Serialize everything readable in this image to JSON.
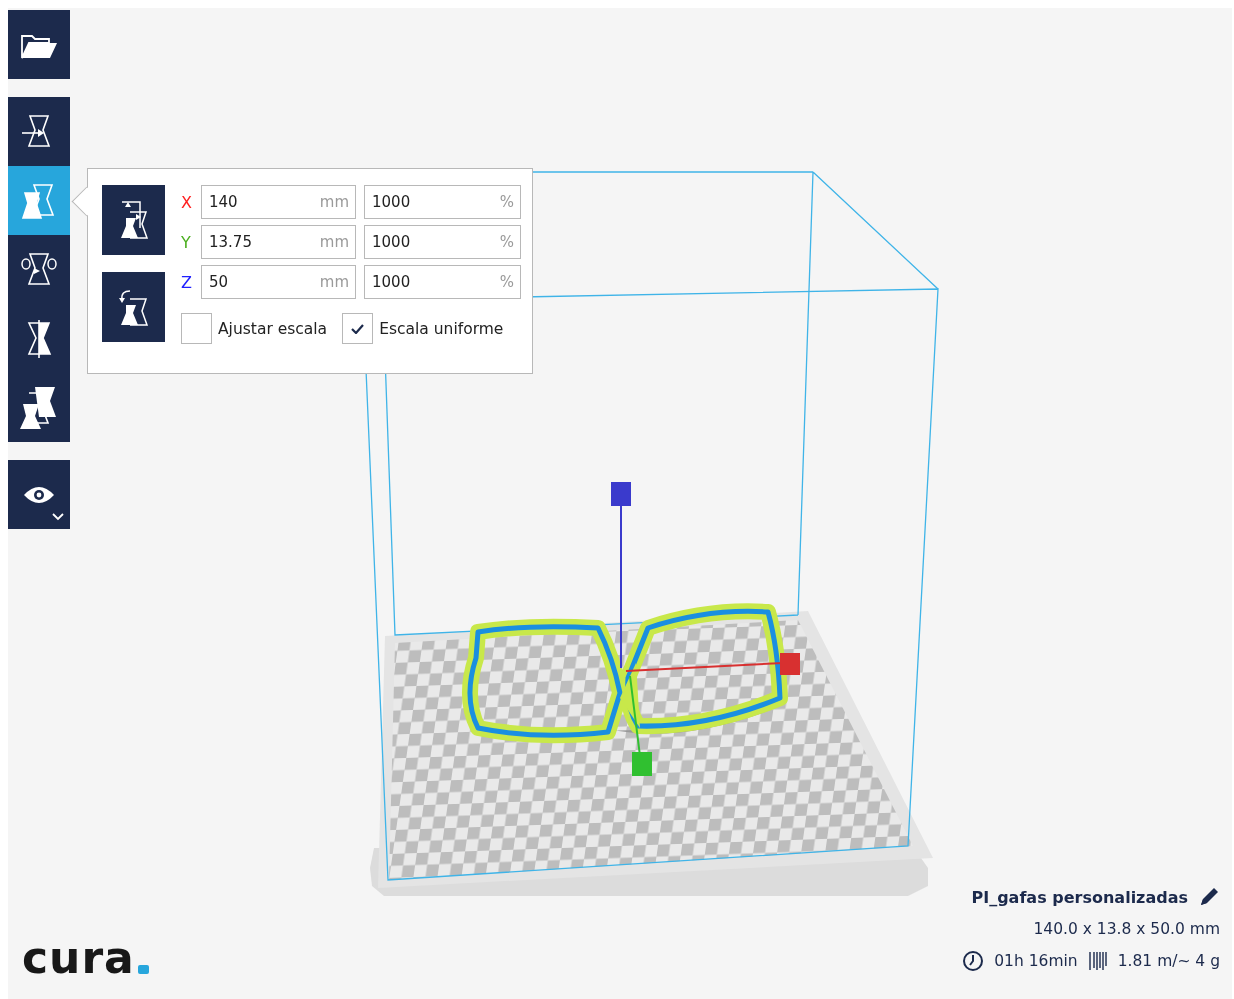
{
  "toolbar": {
    "open": {
      "kind": "open"
    },
    "tools": [
      {
        "kind": "move",
        "selected": false
      },
      {
        "kind": "scale",
        "selected": true
      },
      {
        "kind": "rotate",
        "selected": false
      },
      {
        "kind": "mirror",
        "selected": false
      },
      {
        "kind": "per-model",
        "selected": false
      }
    ],
    "view": {
      "kind": "eye"
    }
  },
  "scale_panel": {
    "buttons": [
      {
        "kind": "reset"
      },
      {
        "kind": "lay-flat"
      }
    ],
    "axes": [
      {
        "label": "X",
        "color": "#ff2020",
        "size": "140",
        "size_unit": "mm",
        "percent": "1000",
        "percent_unit": "%"
      },
      {
        "label": "Y",
        "color": "#4caf20",
        "size": "13.75",
        "size_unit": "mm",
        "percent": "1000",
        "percent_unit": "%"
      },
      {
        "label": "Z",
        "color": "#2020ff",
        "size": "50",
        "size_unit": "mm",
        "percent": "1000",
        "percent_unit": "%"
      }
    ],
    "checkboxes": [
      {
        "label": "Ajustar escala",
        "checked": false
      },
      {
        "label": "Escala uniforme",
        "checked": true
      }
    ]
  },
  "logo": {
    "text": "cura"
  },
  "job": {
    "name": "PI_gafas personalizadas",
    "dimensions": "140.0 x 13.8 x 50.0 mm",
    "time": "01h 16min",
    "material": "1.81 m/~ 4 g"
  }
}
